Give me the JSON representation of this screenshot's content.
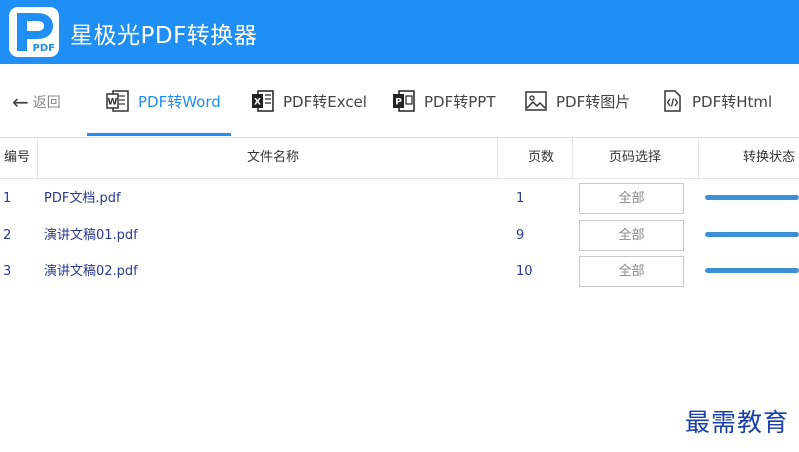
{
  "app": {
    "logo_text": "PDF",
    "title": "星极光PDF转换器"
  },
  "nav": {
    "back_label": "返回",
    "tabs": [
      {
        "label": "PDF转Word",
        "icon": "word-icon",
        "active": true
      },
      {
        "label": "PDF转Excel",
        "icon": "excel-icon",
        "active": false
      },
      {
        "label": "PDF转PPT",
        "icon": "ppt-icon",
        "active": false
      },
      {
        "label": "PDF转图片",
        "icon": "image-icon",
        "active": false
      },
      {
        "label": "PDF转Html",
        "icon": "html-icon",
        "active": false
      }
    ]
  },
  "table": {
    "headers": {
      "index": "编号",
      "name": "文件名称",
      "pages": "页数",
      "page_select": "页码选择",
      "status": "转换状态"
    },
    "rows": [
      {
        "index": "1",
        "name": "PDF文档.pdf",
        "pages": "1",
        "page_select": "全部",
        "progress": 1.0
      },
      {
        "index": "2",
        "name": "演讲文稿01.pdf",
        "pages": "9",
        "page_select": "全部",
        "progress": 1.0
      },
      {
        "index": "3",
        "name": "演讲文稿02.pdf",
        "pages": "10",
        "page_select": "全部",
        "progress": 1.0
      }
    ]
  },
  "watermark": "最需教育",
  "colors": {
    "accent": "#1f8ff5",
    "progress": "#3d8fd6",
    "row_text": "#2b3a8f"
  }
}
